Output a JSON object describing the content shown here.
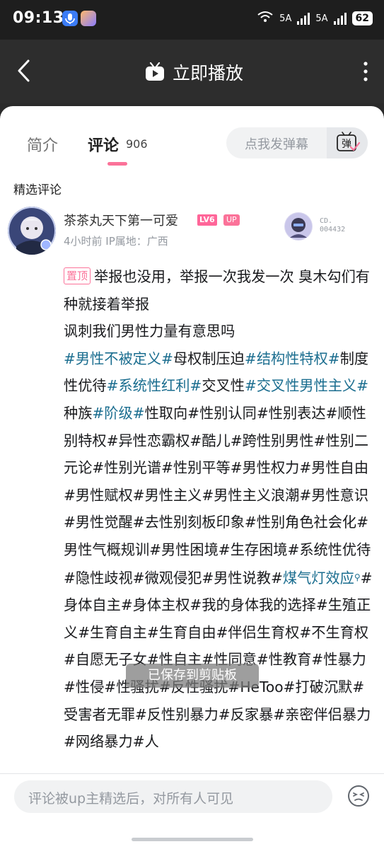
{
  "status_bar": {
    "time": "09:13",
    "network_1": "5A",
    "network_2": "5A",
    "battery": "62"
  },
  "top_bar": {
    "title": "立即播放"
  },
  "tabs": {
    "intro": "简介",
    "comments": "评论",
    "comment_count": "906"
  },
  "danmaku": {
    "placeholder": "点我发弹幕",
    "button_glyph": "弹"
  },
  "section_title": "精选评论",
  "comment": {
    "username": "茶茶丸天下第一可爱",
    "level_badge": "LV6",
    "up_badge": "UP",
    "meta": "4小时前 IP属地：广西",
    "fan_no_label": "CD.",
    "fan_no_value": "004432",
    "pin_label": "置顶",
    "segments": [
      {
        "t": "举报也没用，举报一次我发一次 臭木勾们有种就接着举报",
        "tag": false
      },
      {
        "t": "\n讽刺我们男性力量有意思吗\n",
        "tag": false
      },
      {
        "t": "#男性不被定义#",
        "tag": true
      },
      {
        "t": "母权制压迫",
        "tag": false
      },
      {
        "t": "#结构性特权#",
        "tag": true
      },
      {
        "t": "制度性优待",
        "tag": false
      },
      {
        "t": "#系统性红利#",
        "tag": true
      },
      {
        "t": "交叉性",
        "tag": false
      },
      {
        "t": "#交叉性男性主义#",
        "tag": true
      },
      {
        "t": "种族",
        "tag": false
      },
      {
        "t": "#阶级#",
        "tag": true
      },
      {
        "t": "性取向#性别认同#性别表达#顺性别特权#异性恋霸权#酷儿#跨性别男性#性别二元论#性别光谱#性别平等#男性权力#男性自由#男性赋权#男性主义#男性主义浪潮#男性意识#男性觉醒#去性别刻板印象#性别角色社会化#男性气概规训#男性困境#生存困境#系统性优待#隐性歧视#微观侵犯#男性说教#",
        "tag": false
      },
      {
        "t": "煤气灯效应",
        "tag": true
      },
      {
        "t": "#身体自主#身体主权#我的身体我的选择#生殖正义#生育自主#生育自由#伴侣生育权#不生育权#自愿无子女#性自主#性同意#性教育#性暴力#性侵#性骚扰#反性骚扰#HeToo#打破沉默#受害者无罪#反性别暴力#反家暴#亲密伴侣暴力#网络暴力#人",
        "tag": false
      }
    ]
  },
  "toast": "已保存到剪贴板",
  "comment_input": {
    "placeholder": "评论被up主精选后，对所有人可见"
  },
  "colors": {
    "accent_pink": "#fb7299",
    "tag_blue": "#1a6d8f",
    "gray_text": "#9499a0"
  },
  "icons": [
    "back-arrow-icon",
    "tv-icon",
    "more-vertical-icon",
    "danmaku-icon",
    "search-icon",
    "emoji-icon",
    "wifi-icon",
    "microphone-icon"
  ]
}
